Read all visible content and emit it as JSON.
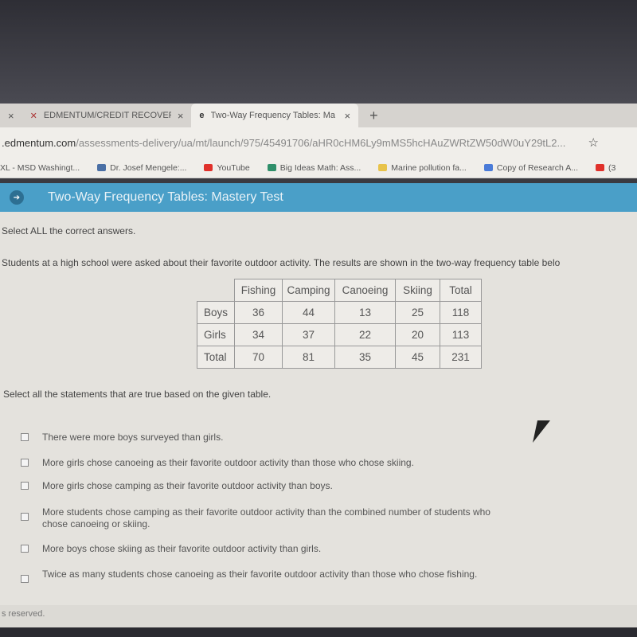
{
  "browser": {
    "tabs": [
      {
        "label": "EDMENTUM/CREDIT RECOVERY",
        "close": "×"
      },
      {
        "label": "Two-Way Frequency Tables: Ma",
        "close": "×"
      }
    ],
    "first_tab_close": "×",
    "new_tab": "+",
    "url_host": ".edmentum.com",
    "url_path": "/assessments-delivery/ua/mt/launch/975/45491706/aHR0cHM6Ly9mMS5hcHAuZWRtZW50dW0uY29tL2...",
    "star_icon": "☆",
    "bookmarks": [
      {
        "label": "XL - MSD Washingt...",
        "color": "#ffffff"
      },
      {
        "label": "Dr. Josef Mengele:...",
        "color": "#4a6fa5"
      },
      {
        "label": "YouTube",
        "color": "#e0312b"
      },
      {
        "label": "Big Ideas Math: Ass...",
        "color": "#2f8f6a"
      },
      {
        "label": "Marine pollution fa...",
        "color": "#e8c34a"
      },
      {
        "label": "Copy of Research A...",
        "color": "#4a7bd8"
      },
      {
        "label": "(3",
        "color": "#e0312b"
      }
    ]
  },
  "header": {
    "title": "Two-Way Frequency Tables: Mastery Test",
    "accent": "#4a9fc8"
  },
  "question": {
    "instruction": "Select ALL the correct answers.",
    "prompt": "Students at a high school were asked about their favorite outdoor activity. The results are shown in the two-way frequency table belo",
    "table": {
      "columns": [
        "Fishing",
        "Camping",
        "Canoeing",
        "Skiing",
        "Total"
      ],
      "rows": [
        {
          "label": "Boys",
          "values": [
            "36",
            "44",
            "13",
            "25",
            "118"
          ]
        },
        {
          "label": "Girls",
          "values": [
            "34",
            "37",
            "22",
            "20",
            "113"
          ]
        },
        {
          "label": "Total",
          "values": [
            "70",
            "81",
            "35",
            "45",
            "231"
          ]
        }
      ]
    },
    "subprompt": "Select all the statements that are true based on the given table.",
    "options": [
      "There were more boys surveyed than girls.",
      "More girls chose canoeing as their favorite outdoor activity than those who chose skiing.",
      "More girls chose camping as their favorite outdoor activity than boys.",
      "More students chose camping as their favorite outdoor activity than the combined number of students who chose canoeing or skiing.",
      "More boys chose skiing as their favorite outdoor activity than girls.",
      "Twice as many students chose canoeing as their favorite outdoor activity than those who chose fishing."
    ]
  },
  "footer": {
    "text": "s reserved."
  }
}
